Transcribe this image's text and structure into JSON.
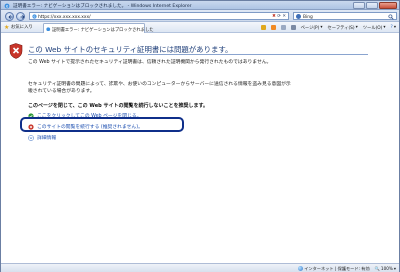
{
  "window": {
    "title": "証明書エラー: ナビゲーションはブロックされました。 - Windows Internet Explorer"
  },
  "addressbar": {
    "url": "https://xxx.xxx.xxx.xxx/",
    "search_text": "Bing"
  },
  "command_bar": {
    "favorites_label": "お気に入り",
    "tab_title": "証明書エラー: ナビゲーションはブロックされました",
    "page_label": "ページ(P)",
    "safety_label": "セーフティ(S)",
    "tools_label": "ツール(O)"
  },
  "content": {
    "headline": "この Web サイトのセキュリティ証明書には問題があります。",
    "para1": "この Web サイトで提示されたセキュリティ証明書は、信頼された証明機関から発行されたものではありません。",
    "para2": "セキュリティ証明書の問題によって、詐欺や、お使いのコンピューターからサーバーに送信される情報を盗み見る意図が示唆されている場合があります。",
    "recommendation": "このページを閉じて、この Web サイトの閲覧を続行しないことを推奨します。",
    "option_close": "ここをクリックしてこの Web ページを閉じる。",
    "option_continue": "このサイトの閲覧を続行する (推奨されません)。",
    "option_more_info": "詳細情報"
  },
  "statusbar": {
    "zone": "インターネット | 保護モード: 有効",
    "zoom": "100%"
  }
}
